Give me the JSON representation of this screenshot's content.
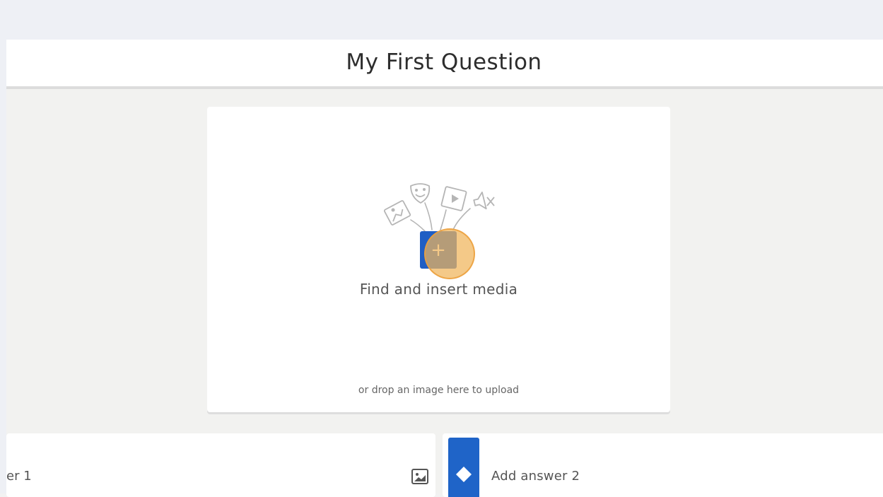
{
  "question": {
    "title": "My First Question"
  },
  "media": {
    "add_button_icon": "+",
    "find_label": "Find and insert media",
    "drop_hint": "or drop an image here to upload",
    "illustration_icons": [
      "image-icon",
      "theater-mask-icon",
      "video-film-icon",
      "speaker-muted-icon"
    ]
  },
  "answers": [
    {
      "text": "er 1",
      "icon": "image-icon"
    },
    {
      "text": "Add answer 2",
      "icon": "diamond-icon",
      "color": "#1f64c8"
    }
  ],
  "colors": {
    "accent_blue": "#1f5ec4",
    "highlight_orange": "#f0b45a"
  }
}
